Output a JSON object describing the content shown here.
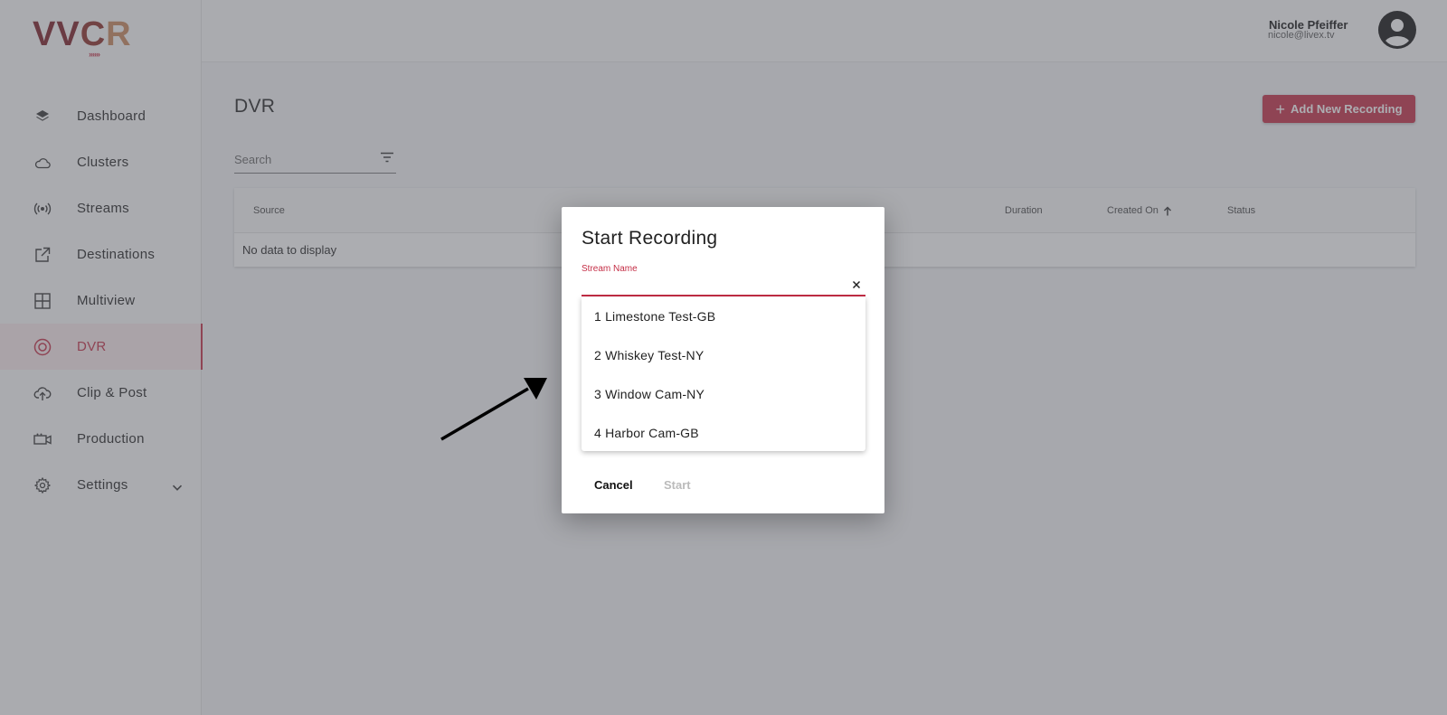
{
  "logo": {
    "part1": "VV",
    "part2": "C",
    "part3": "R",
    "chevrons": "››››››"
  },
  "sidebar": {
    "items": [
      {
        "label": "Dashboard",
        "icon": "layers-icon"
      },
      {
        "label": "Clusters",
        "icon": "cloud-icon"
      },
      {
        "label": "Streams",
        "icon": "broadcast-icon"
      },
      {
        "label": "Destinations",
        "icon": "external-link-icon"
      },
      {
        "label": "Multiview",
        "icon": "grid-icon"
      },
      {
        "label": "DVR",
        "icon": "record-icon",
        "active": true
      },
      {
        "label": "Clip & Post",
        "icon": "cloud-upload-icon"
      },
      {
        "label": "Production",
        "icon": "camera-icon"
      },
      {
        "label": "Settings",
        "icon": "gear-icon"
      }
    ]
  },
  "user": {
    "name": "Nicole Pfeiffer",
    "email": "nicole@livex.tv"
  },
  "page": {
    "title": "DVR",
    "add_button": "Add New Recording"
  },
  "search": {
    "placeholder": "Search"
  },
  "table": {
    "columns": {
      "source": "Source",
      "duration": "Duration",
      "created_on": "Created On",
      "status": "Status"
    },
    "empty_text": "No data to display"
  },
  "dialog": {
    "title": "Start Recording",
    "field_label": "Stream Name",
    "options": [
      "1 Limestone Test-GB",
      "2 Whiskey Test-NY",
      "3 Window Cam-NY",
      "4 Harbor Cam-GB"
    ],
    "cancel_label": "Cancel",
    "start_label": "Start"
  },
  "colors": {
    "accent": "#c42d45",
    "overlay": "#5a5c64"
  }
}
